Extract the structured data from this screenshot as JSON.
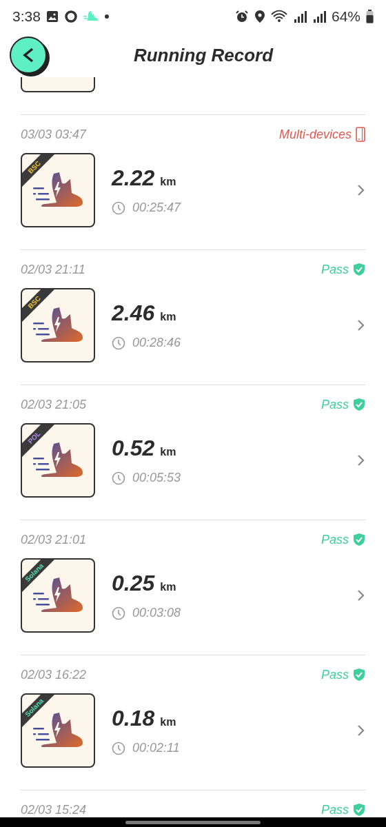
{
  "status_bar": {
    "time": "3:38",
    "battery": "64%"
  },
  "header": {
    "title": "Running Record"
  },
  "records": [
    {
      "date": "03/03 03:47",
      "chain": {
        "label": "BSC",
        "color": "#f2c230"
      },
      "distance": "2.22",
      "unit": "km",
      "duration": "00:25:47",
      "status": {
        "kind": "multi",
        "label": "Multi-devices"
      }
    },
    {
      "date": "02/03 21:11",
      "chain": {
        "label": "BSC",
        "color": "#f2c230"
      },
      "distance": "2.46",
      "unit": "km",
      "duration": "00:28:46",
      "status": {
        "kind": "pass",
        "label": "Pass"
      }
    },
    {
      "date": "02/03 21:05",
      "chain": {
        "label": "POL",
        "color": "#a98be8"
      },
      "distance": "0.52",
      "unit": "km",
      "duration": "00:05:53",
      "status": {
        "kind": "pass",
        "label": "Pass"
      }
    },
    {
      "date": "02/03 21:01",
      "chain": {
        "label": "Solana",
        "color": "#4fe0b0"
      },
      "distance": "0.25",
      "unit": "km",
      "duration": "00:03:08",
      "status": {
        "kind": "pass",
        "label": "Pass"
      }
    },
    {
      "date": "02/03 16:22",
      "chain": {
        "label": "Solana",
        "color": "#4fe0b0"
      },
      "distance": "0.18",
      "unit": "km",
      "duration": "00:02:11",
      "status": {
        "kind": "pass",
        "label": "Pass"
      }
    },
    {
      "date": "02/03 15:24",
      "status": {
        "kind": "pass",
        "label": "Pass"
      }
    }
  ]
}
